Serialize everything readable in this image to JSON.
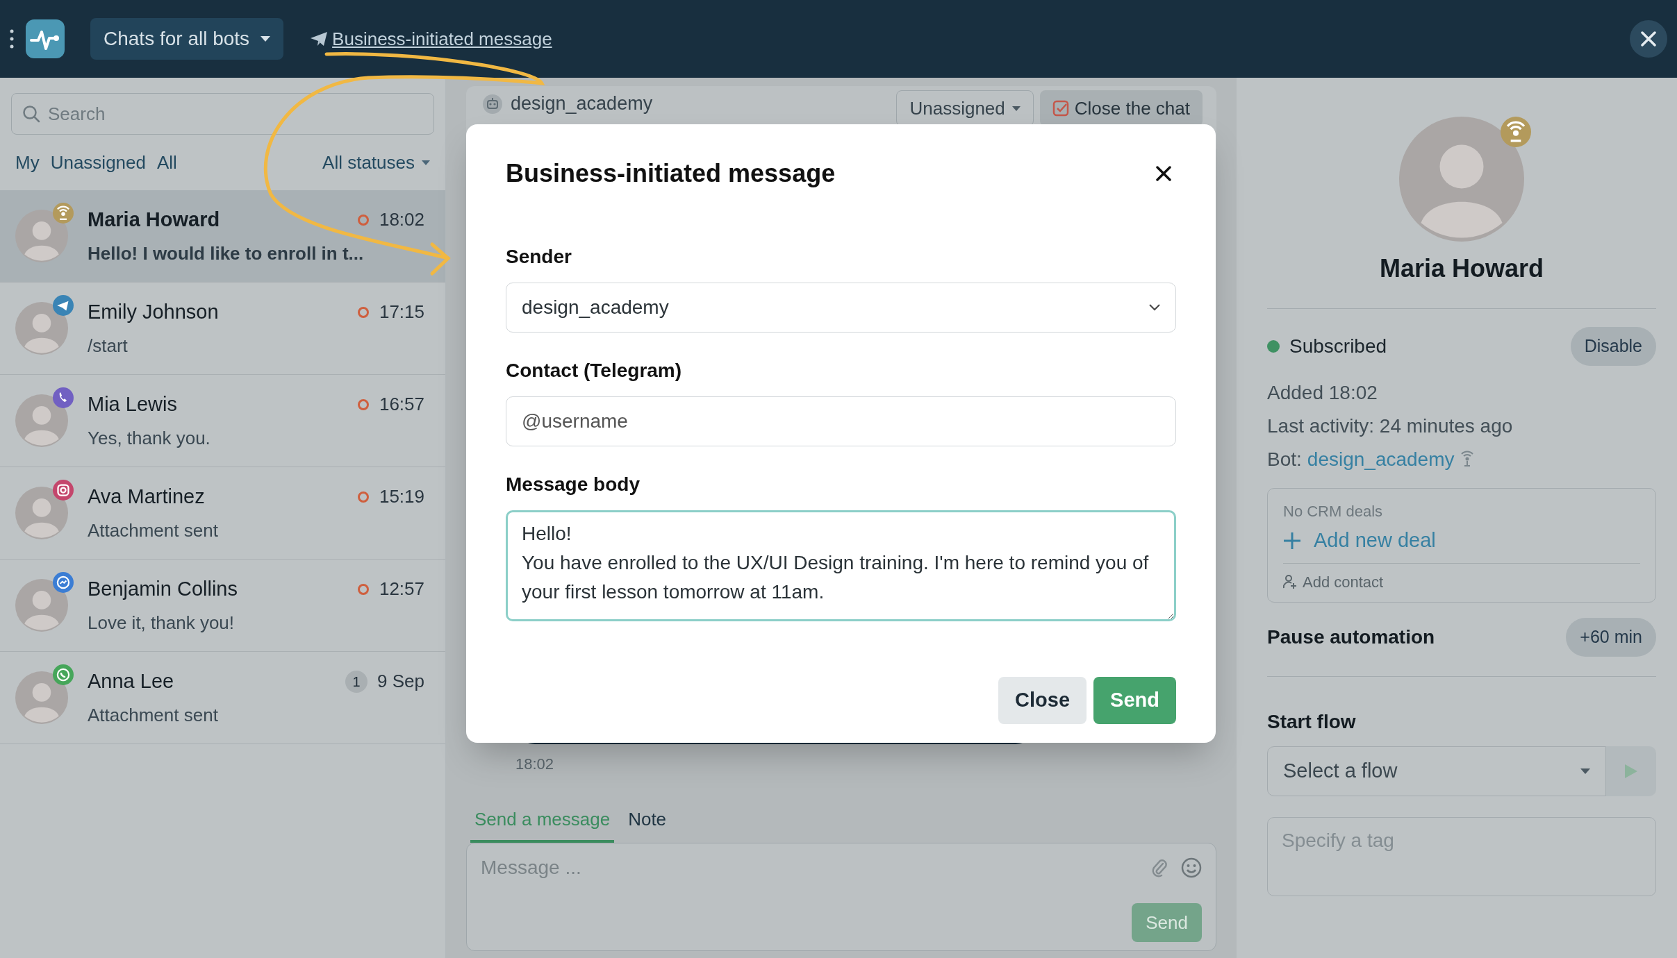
{
  "top_bar": {
    "bots_menu": "Chats for all bots",
    "link": "Business-initiated message"
  },
  "sidebar": {
    "search": {
      "placeholder": "Search"
    },
    "filters": [
      "My",
      "Unassigned",
      "All"
    ],
    "status_filter": "All statuses",
    "chats": [
      {
        "name": "Maria Howard",
        "preview": "Hello! I would like to enroll in t...",
        "time": "18:02",
        "kind": "bot",
        "waiting": true,
        "selected": true
      },
      {
        "name": "Emily Johnson",
        "preview": "/start",
        "time": "17:15",
        "kind": "telegram",
        "waiting": true,
        "selected": false
      },
      {
        "name": "Mia Lewis",
        "preview": "Yes, thank you.",
        "time": "16:57",
        "kind": "viber",
        "waiting": true,
        "selected": false
      },
      {
        "name": "Ava Martinez",
        "preview": "Attachment sent",
        "time": "15:19",
        "kind": "instagram",
        "waiting": true,
        "selected": false
      },
      {
        "name": "Benjamin Collins",
        "preview": "Love it, thank you!",
        "time": "12:57",
        "kind": "messenger",
        "waiting": true,
        "selected": false
      },
      {
        "name": "Anna Lee",
        "preview": "Attachment sent",
        "time": "9 Sep",
        "kind": "whatsapp",
        "waiting": false,
        "unread": "1",
        "selected": false
      }
    ]
  },
  "chat": {
    "bot": "design_academy",
    "assignee": "Unassigned",
    "close_button": "Close the chat",
    "last_message_time": "18:02",
    "composer_tabs": [
      {
        "label": "Send a message",
        "selected": true
      },
      {
        "label": "Note",
        "selected": false
      }
    ],
    "composer": {
      "placeholder": "Message ...",
      "send": "Send"
    }
  },
  "contact_panel": {
    "name": "Maria Howard",
    "subscription": {
      "label": "Subscribed",
      "subscribed": true,
      "button": "Disable"
    },
    "added": "Added 18:02",
    "last_activity": "Last activity: 24 minutes ago",
    "bot_label": "Bot:",
    "bot": "design_academy",
    "crm": {
      "empty": "No CRM deals",
      "add_deal": "Add new deal",
      "add_contact": "Add contact"
    },
    "pause": {
      "label": "Pause automation",
      "button": "+60 min"
    },
    "start_flow": {
      "label": "Start flow",
      "placeholder": "Select a flow"
    },
    "tag": {
      "placeholder": "Specify a tag"
    }
  },
  "modal": {
    "title": "Business-initiated message",
    "fields": [
      {
        "kind": "select",
        "label": "Sender",
        "value": "design_academy"
      },
      {
        "kind": "input",
        "label": "Contact (Telegram)",
        "placeholder": "@username"
      },
      {
        "kind": "textarea",
        "label": "Message body",
        "value": "Hello!\nYou have enrolled to the UX/UI Design training. I'm here to remind you of your first lesson tomorrow at 11am."
      }
    ],
    "buttons": [
      {
        "kind": "secondary",
        "label": "Close"
      },
      {
        "kind": "primary",
        "label": "Send"
      }
    ]
  }
}
